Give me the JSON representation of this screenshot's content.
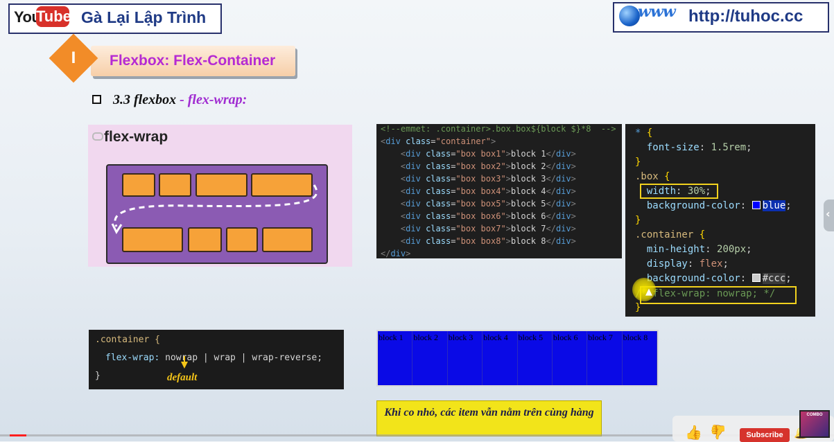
{
  "header": {
    "youtube_logo": {
      "you": "You",
      "tube": "Tube"
    },
    "channel_name": "Gà Lại Lập Trình",
    "website_www": "www",
    "website_url": "http://tuhoc.cc"
  },
  "section": {
    "number": "I",
    "title": "Flexbox: Flex-Container",
    "subsection_num": "3.3 flexbox",
    "subsection_sep": " - ",
    "subsection_prop": "flex-wrap:"
  },
  "illustration": {
    "title": "flex-wrap"
  },
  "html_code": {
    "lines": [
      "<!--emmet: .container>.box.box${block $}*8  -->",
      "<div class=\"container\">",
      "    <div class=\"box box1\">block 1</div>",
      "    <div class=\"box box2\">block 2</div>",
      "    <div class=\"box box3\">block 3</div>",
      "    <div class=\"box box4\">block 4</div>",
      "    <div class=\"box box5\">block 5</div>",
      "    <div class=\"box box6\">block 6</div>",
      "    <div class=\"box box7\">block 7</div>",
      "    <div class=\"box box8\">block 8</div>",
      "</div>"
    ]
  },
  "css_code": {
    "star_selector": "*",
    "open_brace": "{",
    "close_brace": "}",
    "font_size_prop": "font-size",
    "font_size_val": "1.5rem",
    "box_selector": ".box",
    "width_prop": "width",
    "width_val": "30%",
    "bg_prop": "background-color",
    "bg_val_box": "blue",
    "container_selector": ".container",
    "min_height_prop": "min-height",
    "min_height_val": "200px",
    "display_prop": "display",
    "display_val": "flex",
    "bg_val_container": "#ccc",
    "comment_line": "/* flex-wrap: nowrap; */"
  },
  "syntax_code": {
    "selector": ".container {",
    "prop": "flex-wrap:",
    "values": "nowrap | wrap | wrap-reverse;",
    "close": "}",
    "default_label": "default"
  },
  "demo": {
    "blocks": [
      "block 1",
      "block 2",
      "block 3",
      "block 4",
      "block 5",
      "block 6",
      "block 7",
      "block 8"
    ],
    "background": "#0a0ae6"
  },
  "note": {
    "text": "Khi co nhỏ, các item vẫn nằm trên cùng hàng"
  },
  "player": {
    "subscribe_label": "Subscribe",
    "progress_fraction": 0.02,
    "avatar_label": "COMBO"
  },
  "colors": {
    "accent_purple": "#b52ad3",
    "accent_orange": "#f28c28",
    "highlight_yellow": "#f2d21e",
    "code_bg": "#1e1e1e"
  }
}
